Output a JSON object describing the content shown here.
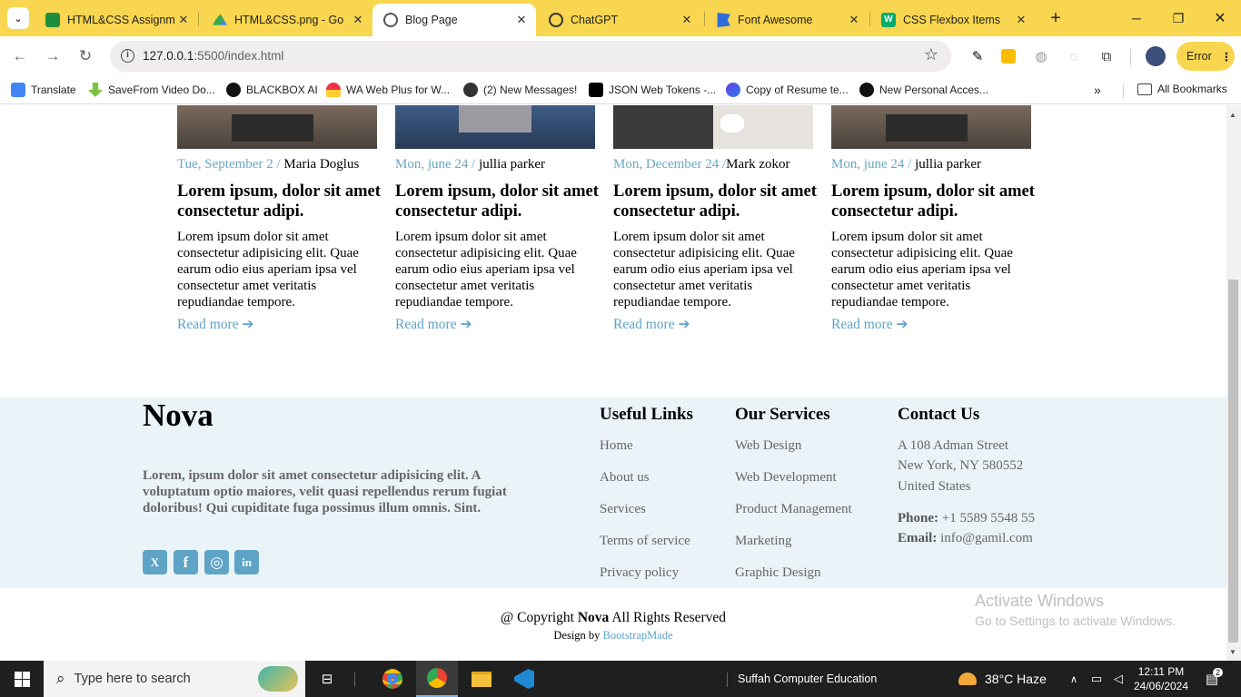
{
  "tabs": [
    {
      "label": "HTML&CSS Assignme",
      "close": "✕"
    },
    {
      "label": "HTML&CSS.png - Go",
      "close": "✕"
    },
    {
      "label": "Blog Page",
      "close": "✕"
    },
    {
      "label": "ChatGPT",
      "close": "✕"
    },
    {
      "label": "Font Awesome",
      "close": "✕"
    },
    {
      "label": "CSS Flexbox Items",
      "close": "✕"
    }
  ],
  "toolbar": {
    "url_host": "127.0.0.1",
    "url_path": ":5500/index.html",
    "error_label": "Error"
  },
  "bookmarks": [
    {
      "label": "Translate"
    },
    {
      "label": "SaveFrom Video Do..."
    },
    {
      "label": "BLACKBOX AI"
    },
    {
      "label": "WA Web Plus for W..."
    },
    {
      "label": "(2) New Messages!"
    },
    {
      "label": "JSON Web Tokens -..."
    },
    {
      "label": "Copy of Resume te..."
    },
    {
      "label": "New Personal Acces..."
    }
  ],
  "all_bookmarks": "All Bookmarks",
  "cards": [
    {
      "date": "Tue, September 2",
      "sep": " / ",
      "author": "Maria Doglus",
      "title": "Lorem ipsum, dolor sit amet consectetur adipi.",
      "body": "Lorem ipsum dolor sit amet consectetur adipisicing elit. Quae earum odio eius aperiam ipsa vel consectetur amet veritatis repudiandae tempore.",
      "more": "Read more"
    },
    {
      "date": "Mon, june 24",
      "sep": " / ",
      "author": "jullia parker",
      "title": "Lorem ipsum, dolor sit amet consectetur adipi.",
      "body": "Lorem ipsum dolor sit amet consectetur adipisicing elit. Quae earum odio eius aperiam ipsa vel consectetur amet veritatis repudiandae tempore.",
      "more": "Read more"
    },
    {
      "date": "Mon, December 24",
      "sep": " /",
      "author": "Mark zokor",
      "title": "Lorem ipsum, dolor sit amet consectetur adipi.",
      "body": "Lorem ipsum dolor sit amet consectetur adipisicing elit. Quae earum odio eius aperiam ipsa vel consectetur amet veritatis repudiandae tempore.",
      "more": "Read more"
    },
    {
      "date": "Mon, june 24",
      "sep": " / ",
      "author": "jullia parker",
      "title": "Lorem ipsum, dolor sit amet consectetur adipi.",
      "body": "Lorem ipsum dolor sit amet consectetur adipisicing elit. Quae earum odio eius aperiam ipsa vel consectetur amet veritatis repudiandae tempore.",
      "more": "Read more"
    }
  ],
  "footer": {
    "brand": "Nova",
    "about": "Lorem, ipsum dolor sit amet consectetur adipisicing elit. A voluptatum optio maiores, velit quasi repellendus rerum fugiat doloribus! Qui cupiditate fuga possimus illum omnis. Sint.",
    "useful_title": "Useful Links",
    "useful_links": [
      "Home",
      "About us",
      "Services",
      "Terms of service",
      "Privacy policy"
    ],
    "services_title": "Our Services",
    "services": [
      "Web Design",
      "Web Development",
      "Product Management",
      "Marketing",
      "Graphic Design"
    ],
    "contact_title": "Contact Us",
    "address": [
      "A 108 Adman Street",
      "New York, NY 580552",
      "United States"
    ],
    "phone_label": "Phone:",
    "phone": "+1 5589 5548 55",
    "email_label": "Email:",
    "email": "info@gamil.com",
    "social": [
      "X",
      "f",
      "◎",
      "in"
    ]
  },
  "copyright": {
    "prefix": "@ Copyright ",
    "brand": "Nova",
    "suffix": " All Rights Reserved"
  },
  "designby": {
    "prefix": "Design by ",
    "link": "BootstrapMade"
  },
  "activate": {
    "title": "Activate Windows",
    "subtitle": "Go to Settings to activate Windows."
  },
  "taskbar": {
    "search_placeholder": "Type here to search",
    "app_label": "Suffah Computer Education",
    "weather": "38°C  Haze",
    "time": "12:11 PM",
    "date": "24/06/2024",
    "notif_count": "2"
  },
  "colors": {
    "accent": "#5fa3c6",
    "chrome_yellow": "#f9d64f",
    "footer_bg": "#eaf3f8"
  }
}
